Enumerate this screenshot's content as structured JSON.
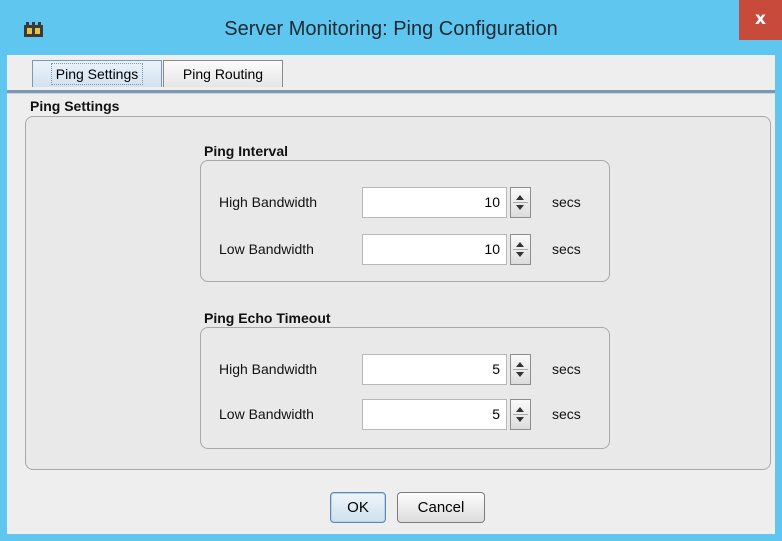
{
  "window": {
    "title": "Server Monitoring: Ping Configuration",
    "close_label": "x",
    "accent_color": "#5fc6ef",
    "close_color": "#c74a3b"
  },
  "tabs": [
    {
      "label": "Ping Settings",
      "active": true
    },
    {
      "label": "Ping Routing",
      "active": false
    }
  ],
  "panel": {
    "title": "Ping Settings",
    "groups": [
      {
        "label": "Ping Interval",
        "rows": [
          {
            "label": "High Bandwidth",
            "value": "10",
            "unit": "secs"
          },
          {
            "label": "Low Bandwidth",
            "value": "10",
            "unit": "secs"
          }
        ]
      },
      {
        "label": "Ping Echo Timeout",
        "rows": [
          {
            "label": "High Bandwidth",
            "value": "5",
            "unit": "secs"
          },
          {
            "label": "Low Bandwidth",
            "value": "5",
            "unit": "secs"
          }
        ]
      }
    ]
  },
  "buttons": {
    "ok": "OK",
    "cancel": "Cancel"
  },
  "icons": {
    "app": "app-icon",
    "close": "close-icon",
    "spin_up": "spin-up-icon",
    "spin_down": "spin-down-icon"
  }
}
